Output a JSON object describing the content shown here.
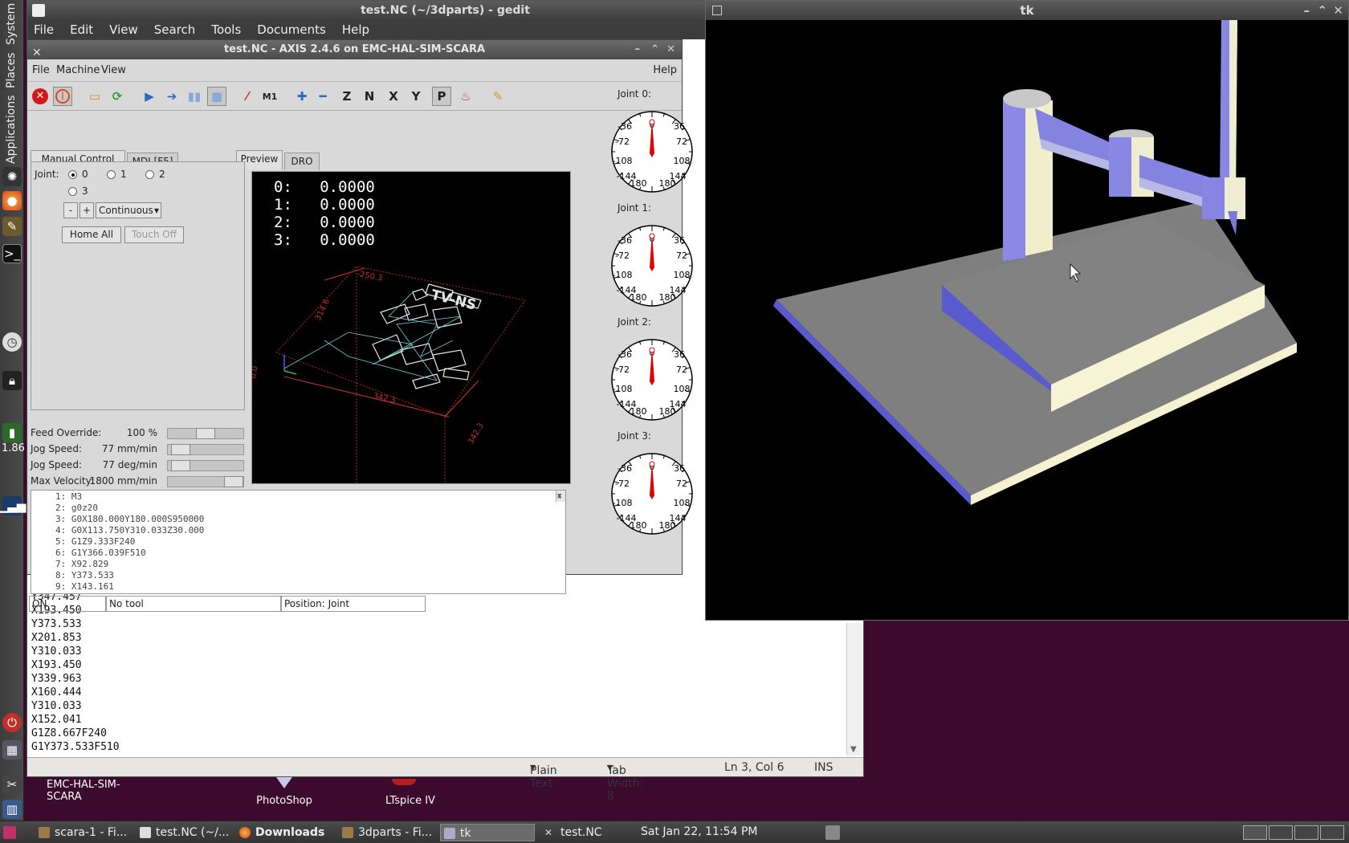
{
  "panel": {
    "menus": [
      "System",
      "Places",
      "Applications"
    ],
    "cpu_freq": "1.86"
  },
  "gedit": {
    "title": "test.NC (~/3dparts) - gedit",
    "menu": [
      "File",
      "Edit",
      "View",
      "Search",
      "Tools",
      "Documents",
      "Help"
    ],
    "lines": [
      "X160.444",
      "Y347.457",
      "X193.450",
      "Y373.533",
      "X201.853",
      "Y310.033",
      "X193.450",
      "Y339.963",
      "X160.444",
      "Y310.033",
      "X152.041",
      "G1Z8.667F240",
      "G1Y373.533F510"
    ],
    "status": {
      "mode": "Plain Text",
      "tab_width": "Tab Width: 8",
      "position": "Ln 3, Col 6",
      "insert": "INS"
    }
  },
  "axis": {
    "title": "test.NC - AXIS 2.4.6 on EMC-HAL-SIM-SCARA",
    "menu": [
      "File",
      "Machine",
      "View"
    ],
    "help": "Help",
    "tabs": {
      "manual": "Manual Control [F3]",
      "mdi": "MDI [F5]",
      "preview": "Preview",
      "dro": "DRO"
    },
    "joint_label": "Joint:",
    "joints": [
      "0",
      "1",
      "2",
      "3"
    ],
    "selected_joint": "0",
    "jog_minus": "-",
    "jog_plus": "+",
    "jog_mode": "Continuous",
    "home_all": "Home All",
    "touch_off": "Touch Off",
    "sliders": [
      {
        "label": "Feed Override:",
        "value": "100 %",
        "fraction": 0.5
      },
      {
        "label": "Jog Speed:",
        "value": "77 mm/min",
        "fraction": 0.05
      },
      {
        "label": "Jog Speed:",
        "value": "77 deg/min",
        "fraction": 0.05
      },
      {
        "label": "Max Velocity:",
        "value": "1800 mm/min",
        "fraction": 1.0
      }
    ],
    "dro": [
      {
        "axis": "0:",
        "value": "0.0000"
      },
      {
        "axis": "1:",
        "value": "0.0000"
      },
      {
        "axis": "2:",
        "value": "0.0000"
      },
      {
        "axis": "3:",
        "value": "0.0000"
      }
    ],
    "preview_labels": [
      "TV-NS",
      "342.3",
      "314.6",
      "0.0",
      "342.3",
      "-250.3"
    ],
    "gcode": [
      "1: M3",
      "2: g0z20",
      "3: G0X180.000Y180.000S950000",
      "4: G0X113.750Y310.033Z30.000",
      "5: G1Z9.333F240",
      "6: G1Y366.039F510",
      "7: X92.829",
      "8: Y373.533",
      "9: X143.161"
    ],
    "status": {
      "state": "ON",
      "tool": "No tool",
      "position": "Position: Joint"
    },
    "gauges": [
      {
        "label": "Joint 0:",
        "ticks": [
          "-36",
          "0",
          "36",
          "-72",
          "72",
          "-108",
          "108",
          "-144",
          "144",
          "-180",
          "180"
        ]
      },
      {
        "label": "Joint 1:",
        "ticks": [
          "-36",
          "0",
          "36",
          "-72",
          "72",
          "-108",
          "108",
          "-144",
          "144",
          "-180",
          "180"
        ]
      },
      {
        "label": "Joint 2:",
        "ticks": [
          "-36",
          "0",
          "36",
          "-72",
          "72",
          "-108",
          "108",
          "-144",
          "144",
          "-180",
          "180"
        ]
      },
      {
        "label": "Joint 3:",
        "ticks": [
          "-36",
          "0",
          "36",
          "-72",
          "72",
          "-108",
          "108",
          "-144",
          "144",
          "-180",
          "180"
        ]
      }
    ]
  },
  "tk": {
    "title": "tk"
  },
  "desktop": {
    "icons": [
      {
        "label": "EMC-HAL-SIM-SCARA"
      },
      {
        "label": "PhotoShop"
      },
      {
        "label": "LTspice IV"
      }
    ]
  },
  "taskbar": {
    "tasks": [
      "scara-1 - Fi...",
      "test.NC (~/...",
      "Downloads",
      "3dparts - Fi...",
      "tk",
      "test.NC"
    ],
    "clock": "Sat Jan 22, 11:54 PM"
  }
}
